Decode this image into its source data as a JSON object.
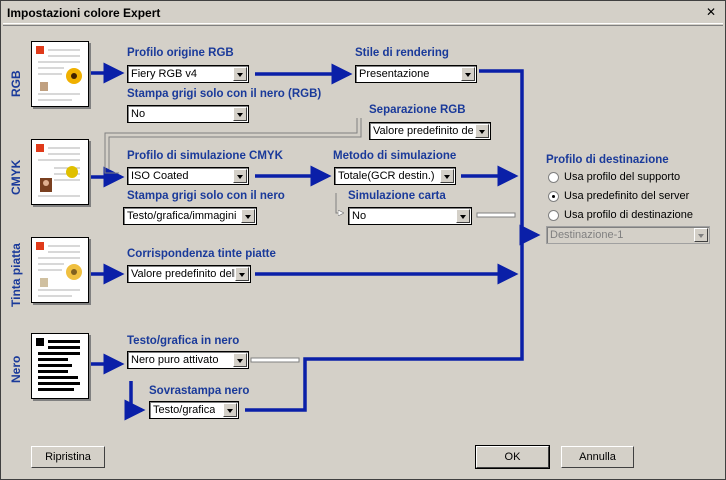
{
  "window": {
    "title": "Impostazioni colore Expert"
  },
  "sections": {
    "rgb": "RGB",
    "cmyk": "CMYK",
    "spot": "Tinta piatta",
    "black": "Nero"
  },
  "rgb": {
    "source_profile_label": "Profilo origine RGB",
    "source_profile_value": "Fiery RGB v4",
    "gray_black_label": "Stampa grigi solo con il nero (RGB)",
    "gray_black_value": "No",
    "rendering_label": "Stile di rendering",
    "rendering_value": "Presentazione",
    "separation_label": "Separazione RGB",
    "separation_value": "Valore predefinito del"
  },
  "cmyk": {
    "sim_profile_label": "Profilo di simulazione CMYK",
    "sim_profile_value": "ISO Coated",
    "gray_black_label": "Stampa grigi solo con il nero",
    "gray_black_value": "Testo/grafica/immagini",
    "sim_method_label": "Metodo di simulazione",
    "sim_method_value": "Totale(GCR destin.)",
    "paper_sim_label": "Simulazione carta",
    "paper_sim_value": "No"
  },
  "spot": {
    "match_label": "Corrispondenza tinte piatte",
    "match_value": "Valore predefinito dell"
  },
  "black": {
    "text_label": "Testo/grafica in nero",
    "text_value": "Nero puro attivato",
    "overprint_label": "Sovrastampa nero",
    "overprint_value": "Testo/grafica"
  },
  "destination": {
    "label": "Profilo di destinazione",
    "options": [
      "Usa profilo del supporto",
      "Usa predefinito del server",
      "Usa profilo di destinazione"
    ],
    "selected_index": 1,
    "profile_value": "Destinazione-1"
  },
  "buttons": {
    "reset": "Ripristina",
    "ok": "OK",
    "cancel": "Annulla"
  },
  "colors": {
    "flow_blue": "#0a1fa8",
    "label_blue": "#1a3a9a"
  },
  "icons": [
    "close-icon",
    "document-sunflower-icon",
    "document-portrait-icon",
    "document-text-icon",
    "fiery-logo-icon",
    "dropdown-arrow-icon"
  ]
}
